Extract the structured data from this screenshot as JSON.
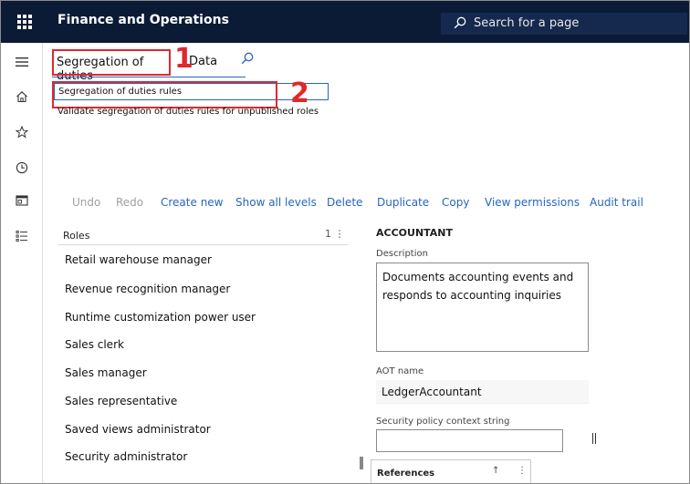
{
  "header": {
    "app_title": "Finance and Operations",
    "search_placeholder": "Search for a page"
  },
  "nav": {
    "icons": [
      "hamburger-icon",
      "home-icon",
      "star-icon",
      "clock-icon",
      "workspace-icon",
      "list-icon"
    ]
  },
  "search_panel": {
    "query": "Segregation of duties",
    "query_suffix": "Data",
    "results": [
      "Segregation of duties rules",
      "Validate segregation of duties rules for unpublished roles"
    ],
    "callouts": [
      "1",
      "2"
    ]
  },
  "toolbar": {
    "items": [
      {
        "label": "Undo",
        "enabled": false
      },
      {
        "label": "Redo",
        "enabled": false
      },
      {
        "label": "Create new",
        "enabled": true
      },
      {
        "label": "Show all levels",
        "enabled": true
      },
      {
        "label": "Delete",
        "enabled": true
      },
      {
        "label": "Duplicate",
        "enabled": true
      },
      {
        "label": "Copy",
        "enabled": true
      },
      {
        "label": "View permissions",
        "enabled": true
      },
      {
        "label": "Audit trail",
        "enabled": true
      }
    ]
  },
  "roles": {
    "header": "Roles",
    "sort_indicator": "1 ⋮",
    "items": [
      "Retail warehouse manager",
      "Revenue recognition manager",
      "Runtime customization power user",
      "Sales clerk",
      "Sales manager",
      "Sales representative",
      "Saved views administrator",
      "Security administrator"
    ]
  },
  "details": {
    "role_name": "ACCOUNTANT",
    "description_label": "Description",
    "description": "Documents accounting events and responds to accounting inquiries",
    "aot_label": "AOT name",
    "aot_value": "LedgerAccountant",
    "context_label": "Security policy context string",
    "context_value": "",
    "references_label": "References",
    "references_sort": "↑",
    "references_menu": "⋮"
  },
  "colors": {
    "topbar": "#0b1b36",
    "accent": "#2566c0",
    "callout": "#e0282e"
  }
}
